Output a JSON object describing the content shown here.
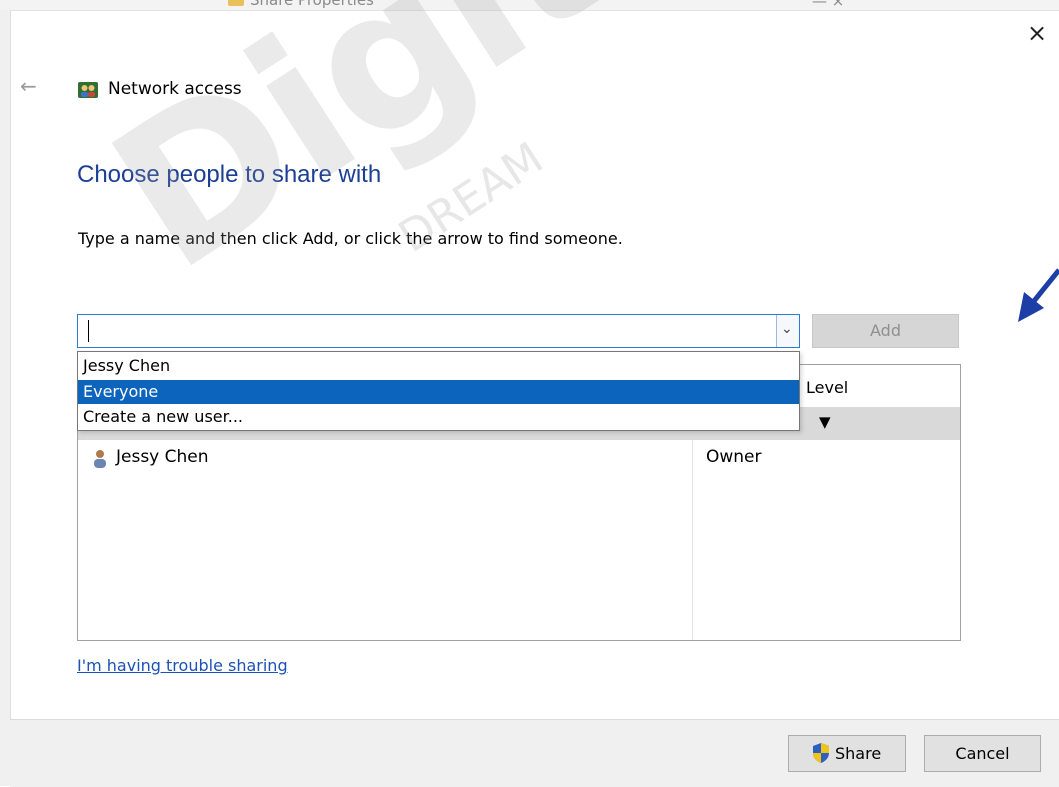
{
  "background_window": {
    "title": "Share Properties"
  },
  "dialog": {
    "close_label": "×",
    "back_label": "←",
    "header_title": "Network access",
    "heading": "Choose people to share with",
    "instruction": "Type a name and then click Add, or click the arrow to find someone.",
    "name_input": {
      "value": ""
    },
    "add_button": "Add",
    "dropdown_options": [
      {
        "label": "Jessy Chen",
        "selected": false
      },
      {
        "label": "Everyone",
        "selected": true
      },
      {
        "label": "Create a new user...",
        "selected": false
      }
    ],
    "table": {
      "permission_header": "Level",
      "rows": [
        {
          "name": "Jessy Chen",
          "permission": "Owner"
        }
      ]
    },
    "trouble_link": "I'm having trouble sharing",
    "share_button": "Share",
    "cancel_button": "Cancel"
  },
  "watermark": {
    "text": "DigitalM",
    "subtext": "DREAM"
  },
  "colors": {
    "heading": "#1c3f94",
    "selection": "#0d64bd",
    "link": "#1a53b5",
    "annotation_arrow": "#1d3ea6"
  }
}
